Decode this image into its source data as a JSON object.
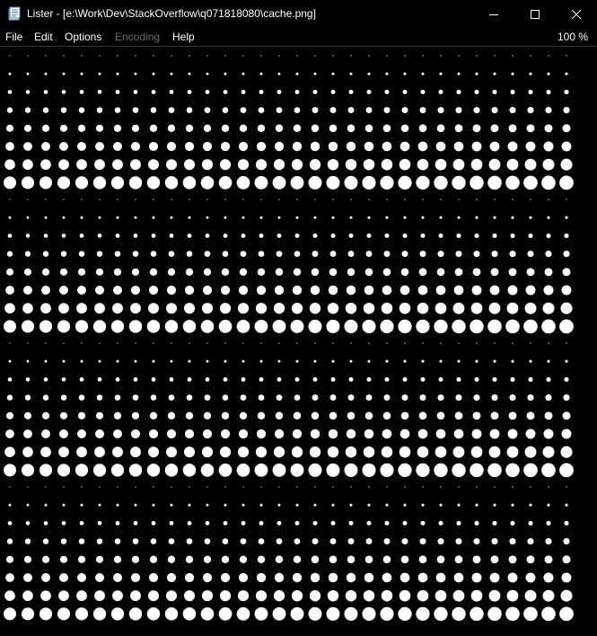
{
  "window": {
    "title": "Lister - [e:\\Work\\Dev\\StackOverflow\\q071818080\\cache.png]",
    "icon": "notepad-document-icon",
    "controls": {
      "minimize": "minimize-icon",
      "maximize": "maximize-icon",
      "close": "close-icon"
    }
  },
  "menu": {
    "items": [
      {
        "label": "File",
        "enabled": true
      },
      {
        "label": "Edit",
        "enabled": true
      },
      {
        "label": "Options",
        "enabled": true
      },
      {
        "label": "Encoding",
        "enabled": false
      },
      {
        "label": "Help",
        "enabled": true
      }
    ],
    "zoom": "100 %"
  },
  "image": {
    "background": "#000000",
    "dot_color": "#ffffff",
    "columns": 32,
    "bands": 4,
    "rows_per_band": 8
  }
}
